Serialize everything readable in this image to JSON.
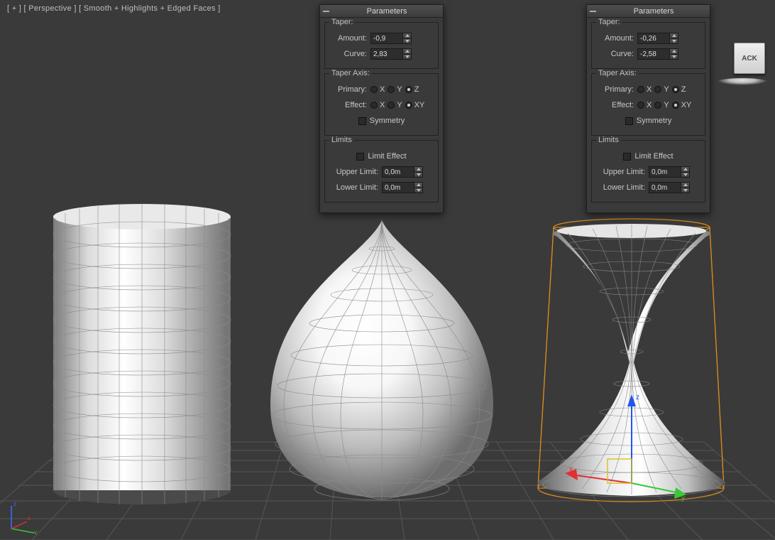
{
  "viewport": {
    "plus": "[ + ]",
    "view": "[ Perspective ]",
    "shading": "[ Smooth + Highlights + Edged Faces ]"
  },
  "panels": [
    {
      "title": "Parameters",
      "taper_label": "Taper:",
      "amount_label": "Amount:",
      "amount_value": "-0,9",
      "curve_label": "Curve:",
      "curve_value": "2,83",
      "axis_label": "Taper Axis:",
      "primary_label": "Primary:",
      "effect_label": "Effect:",
      "x": "X",
      "y": "Y",
      "z": "Z",
      "xy": "XY",
      "primary_selected": "Z",
      "effect_selected": "XY",
      "symmetry_label": "Symmetry",
      "limits_label": "Limits",
      "limit_effect_label": "Limit Effect",
      "upper_label": "Upper Limit:",
      "upper_value": "0,0m",
      "lower_label": "Lower Limit:",
      "lower_value": "0,0m"
    },
    {
      "title": "Parameters",
      "taper_label": "Taper:",
      "amount_label": "Amount:",
      "amount_value": "-0,26",
      "curve_label": "Curve:",
      "curve_value": "-2,58",
      "axis_label": "Taper Axis:",
      "primary_label": "Primary:",
      "effect_label": "Effect:",
      "x": "X",
      "y": "Y",
      "z": "Z",
      "xy": "XY",
      "primary_selected": "Z",
      "effect_selected": "XY",
      "symmetry_label": "Symmetry",
      "limits_label": "Limits",
      "limit_effect_label": "Limit Effect",
      "upper_label": "Upper Limit:",
      "upper_value": "0,0m",
      "lower_label": "Lower Limit:",
      "lower_value": "0,0m"
    }
  ],
  "widgets": {
    "viewcube_face": "ACK"
  },
  "axes": {
    "x": "x",
    "y": "y",
    "z": "z"
  }
}
